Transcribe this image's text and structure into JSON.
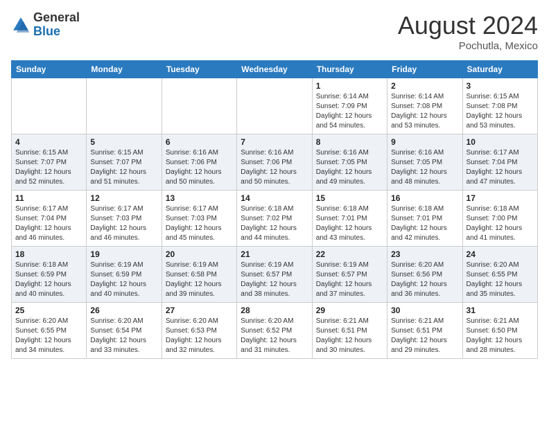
{
  "header": {
    "logo_general": "General",
    "logo_blue": "Blue",
    "month_year": "August 2024",
    "location": "Pochutla, Mexico"
  },
  "days_of_week": [
    "Sunday",
    "Monday",
    "Tuesday",
    "Wednesday",
    "Thursday",
    "Friday",
    "Saturday"
  ],
  "weeks": [
    [
      {
        "day": "",
        "info": ""
      },
      {
        "day": "",
        "info": ""
      },
      {
        "day": "",
        "info": ""
      },
      {
        "day": "",
        "info": ""
      },
      {
        "day": "1",
        "info": "Sunrise: 6:14 AM\nSunset: 7:09 PM\nDaylight: 12 hours\nand 54 minutes."
      },
      {
        "day": "2",
        "info": "Sunrise: 6:14 AM\nSunset: 7:08 PM\nDaylight: 12 hours\nand 53 minutes."
      },
      {
        "day": "3",
        "info": "Sunrise: 6:15 AM\nSunset: 7:08 PM\nDaylight: 12 hours\nand 53 minutes."
      }
    ],
    [
      {
        "day": "4",
        "info": "Sunrise: 6:15 AM\nSunset: 7:07 PM\nDaylight: 12 hours\nand 52 minutes."
      },
      {
        "day": "5",
        "info": "Sunrise: 6:15 AM\nSunset: 7:07 PM\nDaylight: 12 hours\nand 51 minutes."
      },
      {
        "day": "6",
        "info": "Sunrise: 6:16 AM\nSunset: 7:06 PM\nDaylight: 12 hours\nand 50 minutes."
      },
      {
        "day": "7",
        "info": "Sunrise: 6:16 AM\nSunset: 7:06 PM\nDaylight: 12 hours\nand 50 minutes."
      },
      {
        "day": "8",
        "info": "Sunrise: 6:16 AM\nSunset: 7:05 PM\nDaylight: 12 hours\nand 49 minutes."
      },
      {
        "day": "9",
        "info": "Sunrise: 6:16 AM\nSunset: 7:05 PM\nDaylight: 12 hours\nand 48 minutes."
      },
      {
        "day": "10",
        "info": "Sunrise: 6:17 AM\nSunset: 7:04 PM\nDaylight: 12 hours\nand 47 minutes."
      }
    ],
    [
      {
        "day": "11",
        "info": "Sunrise: 6:17 AM\nSunset: 7:04 PM\nDaylight: 12 hours\nand 46 minutes."
      },
      {
        "day": "12",
        "info": "Sunrise: 6:17 AM\nSunset: 7:03 PM\nDaylight: 12 hours\nand 46 minutes."
      },
      {
        "day": "13",
        "info": "Sunrise: 6:17 AM\nSunset: 7:03 PM\nDaylight: 12 hours\nand 45 minutes."
      },
      {
        "day": "14",
        "info": "Sunrise: 6:18 AM\nSunset: 7:02 PM\nDaylight: 12 hours\nand 44 minutes."
      },
      {
        "day": "15",
        "info": "Sunrise: 6:18 AM\nSunset: 7:01 PM\nDaylight: 12 hours\nand 43 minutes."
      },
      {
        "day": "16",
        "info": "Sunrise: 6:18 AM\nSunset: 7:01 PM\nDaylight: 12 hours\nand 42 minutes."
      },
      {
        "day": "17",
        "info": "Sunrise: 6:18 AM\nSunset: 7:00 PM\nDaylight: 12 hours\nand 41 minutes."
      }
    ],
    [
      {
        "day": "18",
        "info": "Sunrise: 6:18 AM\nSunset: 6:59 PM\nDaylight: 12 hours\nand 40 minutes."
      },
      {
        "day": "19",
        "info": "Sunrise: 6:19 AM\nSunset: 6:59 PM\nDaylight: 12 hours\nand 40 minutes."
      },
      {
        "day": "20",
        "info": "Sunrise: 6:19 AM\nSunset: 6:58 PM\nDaylight: 12 hours\nand 39 minutes."
      },
      {
        "day": "21",
        "info": "Sunrise: 6:19 AM\nSunset: 6:57 PM\nDaylight: 12 hours\nand 38 minutes."
      },
      {
        "day": "22",
        "info": "Sunrise: 6:19 AM\nSunset: 6:57 PM\nDaylight: 12 hours\nand 37 minutes."
      },
      {
        "day": "23",
        "info": "Sunrise: 6:20 AM\nSunset: 6:56 PM\nDaylight: 12 hours\nand 36 minutes."
      },
      {
        "day": "24",
        "info": "Sunrise: 6:20 AM\nSunset: 6:55 PM\nDaylight: 12 hours\nand 35 minutes."
      }
    ],
    [
      {
        "day": "25",
        "info": "Sunrise: 6:20 AM\nSunset: 6:55 PM\nDaylight: 12 hours\nand 34 minutes."
      },
      {
        "day": "26",
        "info": "Sunrise: 6:20 AM\nSunset: 6:54 PM\nDaylight: 12 hours\nand 33 minutes."
      },
      {
        "day": "27",
        "info": "Sunrise: 6:20 AM\nSunset: 6:53 PM\nDaylight: 12 hours\nand 32 minutes."
      },
      {
        "day": "28",
        "info": "Sunrise: 6:20 AM\nSunset: 6:52 PM\nDaylight: 12 hours\nand 31 minutes."
      },
      {
        "day": "29",
        "info": "Sunrise: 6:21 AM\nSunset: 6:51 PM\nDaylight: 12 hours\nand 30 minutes."
      },
      {
        "day": "30",
        "info": "Sunrise: 6:21 AM\nSunset: 6:51 PM\nDaylight: 12 hours\nand 29 minutes."
      },
      {
        "day": "31",
        "info": "Sunrise: 6:21 AM\nSunset: 6:50 PM\nDaylight: 12 hours\nand 28 minutes."
      }
    ]
  ]
}
